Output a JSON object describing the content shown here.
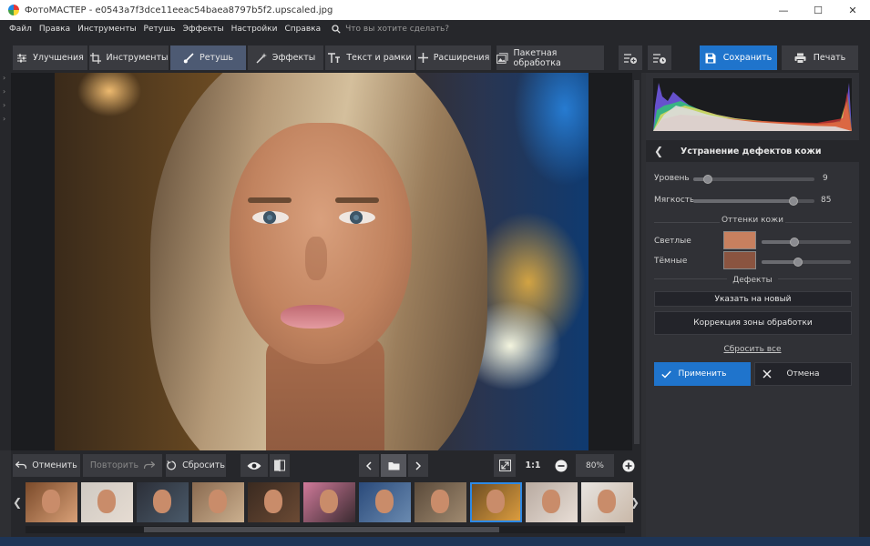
{
  "window": {
    "title": "ФотоМАСТЕР - e0543a7f3dce11eeac54baea8797b5f2.upscaled.jpg",
    "controls": [
      "—",
      "☐",
      "✕"
    ]
  },
  "menu": {
    "items": [
      "Файл",
      "Правка",
      "Инструменты",
      "Ретушь",
      "Эффекты",
      "Настройки",
      "Справка"
    ],
    "search_placeholder": "Что вы хотите сделать?"
  },
  "toolbar": {
    "tabs": [
      "Улучшения",
      "Инструменты",
      "Ретушь",
      "Эффекты",
      "Текст и рамки",
      "Расширения",
      "Пакетная обработка"
    ],
    "active_tab": "Ретушь",
    "save_label": "Сохранить",
    "print_label": "Печать"
  },
  "bottombar": {
    "undo": "Отменить",
    "redo": "Повторить",
    "reset": "Сбросить",
    "zoom_ratio": "1:1",
    "zoom_value": "80%"
  },
  "filmstrip": {
    "count": 11,
    "selected_index": 8
  },
  "panel": {
    "title": "Устранение дефектов кожи",
    "level_label": "Уровень",
    "level_value": "9",
    "level_fraction": 0.09,
    "softness_label": "Мягкость",
    "softness_value": "85",
    "softness_fraction": 0.85,
    "skin_tones_label": "Оттенки кожи",
    "light_label": "Светлые",
    "light_color": "#c7805f",
    "light_fraction": 0.35,
    "dark_label": "Тёмные",
    "dark_color": "#8a5440",
    "dark_fraction": 0.4,
    "defects_label": "Дефекты",
    "point_new": "Указать на новый",
    "correction_zone": "Коррекция зоны обработки",
    "reset_all": "Сбросить все",
    "apply": "Применить",
    "cancel": "Отмена"
  },
  "colors": {
    "accent": "#1f74cc",
    "background": "#2e2f33"
  }
}
